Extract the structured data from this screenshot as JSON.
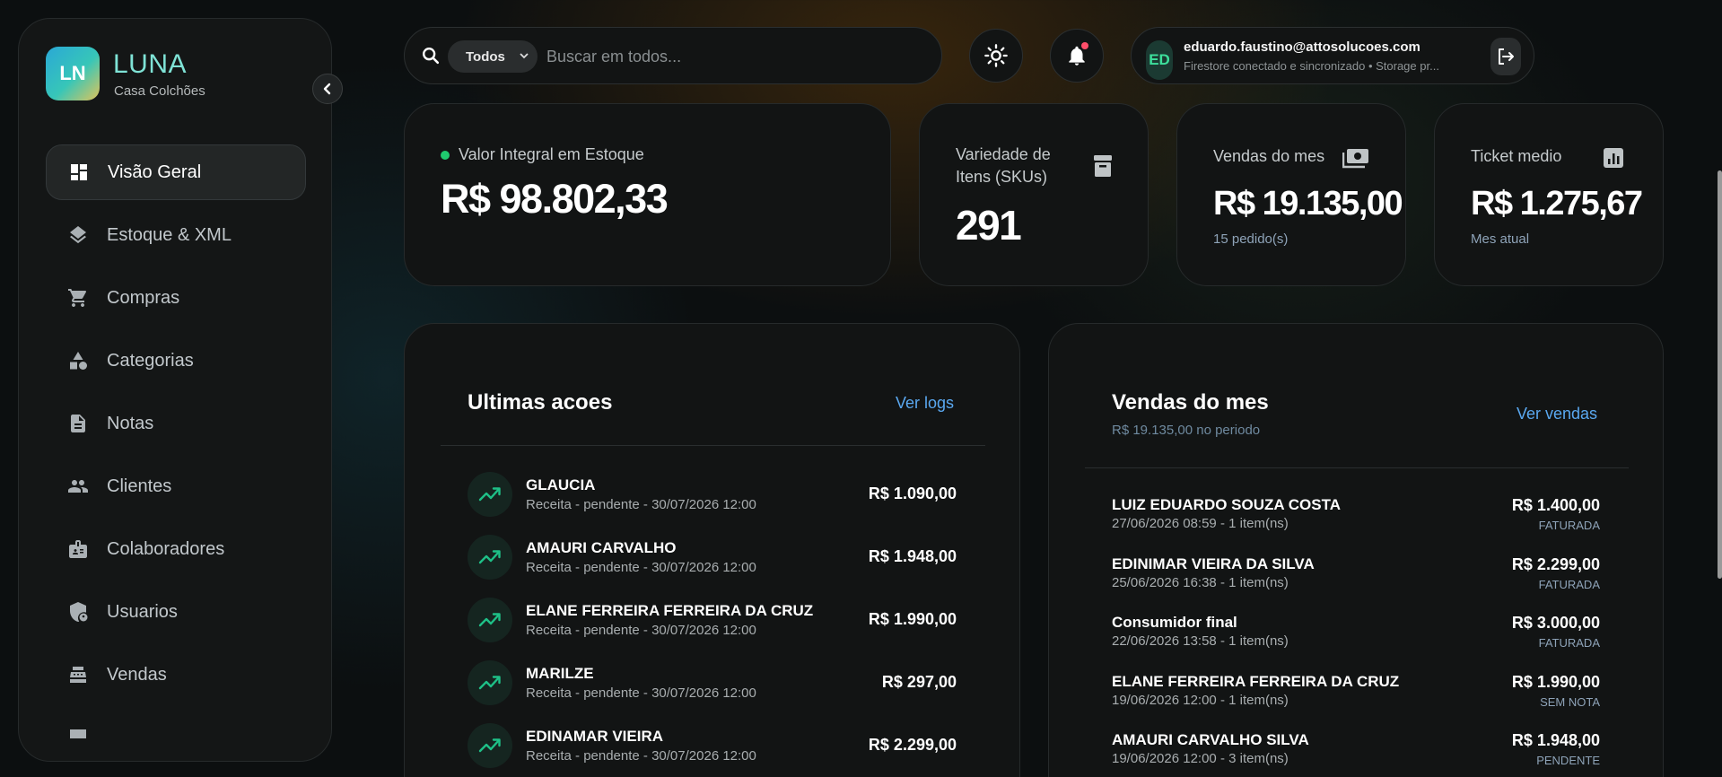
{
  "brand": {
    "logo_text": "LN",
    "title": "LUNA",
    "subtitle": "Casa Colchões"
  },
  "sidebar": {
    "items": [
      {
        "label": "Visão Geral",
        "icon": "dashboard-icon",
        "active": true
      },
      {
        "label": "Estoque & XML",
        "icon": "layers-icon"
      },
      {
        "label": "Compras",
        "icon": "cart-icon"
      },
      {
        "label": "Categorias",
        "icon": "shapes-icon"
      },
      {
        "label": "Notas",
        "icon": "document-icon"
      },
      {
        "label": "Clientes",
        "icon": "people-icon"
      },
      {
        "label": "Colaboradores",
        "icon": "badge-icon"
      },
      {
        "label": "Usuarios",
        "icon": "shield-user-icon"
      },
      {
        "label": "Vendas",
        "icon": "register-icon"
      }
    ]
  },
  "search": {
    "scope": "Todos",
    "placeholder": "Buscar em todos..."
  },
  "user": {
    "initials": "ED",
    "email": "eduardo.faustino@attosolucoes.com",
    "status": "Firestore conectado e sincronizado • Storage pr..."
  },
  "stats": {
    "stock_value": {
      "label": "Valor Integral em Estoque",
      "value": "R$ 98.802,33"
    },
    "skus": {
      "label_line1": "Variedade de",
      "label_line2": "Itens (SKUs)",
      "value": "291"
    },
    "month_sales": {
      "label": "Vendas do mes",
      "value": "R$ 19.135,00",
      "sub": "15 pedido(s)"
    },
    "ticket": {
      "label": "Ticket medio",
      "value": "R$ 1.275,67",
      "sub": "Mes atual"
    }
  },
  "actions_panel": {
    "title": "Ultimas acoes",
    "link": "Ver logs",
    "rows": [
      {
        "name": "GLAUCIA",
        "meta": "Receita - pendente - 30/07/2026 12:00",
        "amount": "R$ 1.090,00"
      },
      {
        "name": "AMAURI CARVALHO",
        "meta": "Receita - pendente - 30/07/2026 12:00",
        "amount": "R$ 1.948,00"
      },
      {
        "name": "ELANE FERREIRA FERREIRA DA CRUZ",
        "meta": "Receita - pendente - 30/07/2026 12:00",
        "amount": "R$ 1.990,00"
      },
      {
        "name": "MARILZE",
        "meta": "Receita - pendente - 30/07/2026 12:00",
        "amount": "R$ 297,00"
      },
      {
        "name": "EDINAMAR VIEIRA",
        "meta": "Receita - pendente - 30/07/2026 12:00",
        "amount": "R$ 2.299,00"
      }
    ]
  },
  "sales_panel": {
    "title": "Vendas do mes",
    "subtitle": "R$ 19.135,00 no periodo",
    "link": "Ver vendas",
    "rows": [
      {
        "name": "LUIZ EDUARDO SOUZA COSTA",
        "meta": "27/06/2026 08:59 - 1 item(ns)",
        "amount": "R$ 1.400,00",
        "status": "FATURADA"
      },
      {
        "name": "EDINIMAR VIEIRA DA SILVA",
        "meta": "25/06/2026 16:38 - 1 item(ns)",
        "amount": "R$ 2.299,00",
        "status": "FATURADA"
      },
      {
        "name": "Consumidor final",
        "meta": "22/06/2026 13:58 - 1 item(ns)",
        "amount": "R$ 3.000,00",
        "status": "FATURADA"
      },
      {
        "name": "ELANE FERREIRA FERREIRA DA CRUZ",
        "meta": "19/06/2026 12:00 - 1 item(ns)",
        "amount": "R$ 1.990,00",
        "status": "SEM NOTA"
      },
      {
        "name": "AMAURI CARVALHO SILVA",
        "meta": "19/06/2026 12:00 - 3 item(ns)",
        "amount": "R$ 1.948,00",
        "status": "PENDENTE"
      }
    ]
  },
  "colors": {
    "accent_link": "#5aa8f0",
    "brand_title": "#7fe3d6",
    "online_dot": "#1fca6e",
    "notification_dot": "#ff4e6a"
  }
}
